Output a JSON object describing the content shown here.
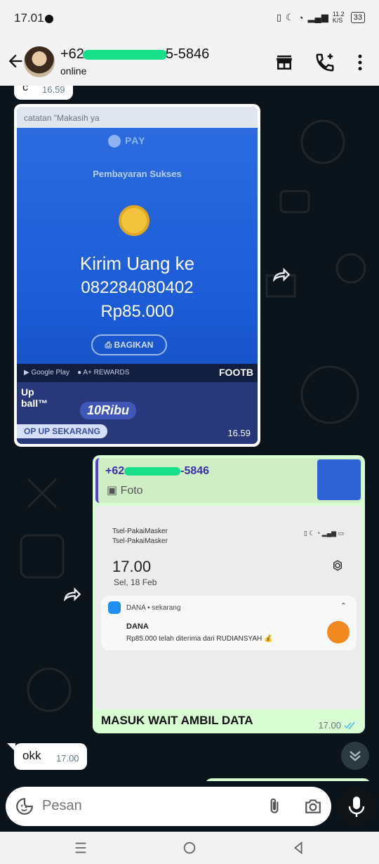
{
  "status_bar": {
    "time": "17.01",
    "net_speed": "11.2 K/S",
    "battery": "33"
  },
  "header": {
    "name_prefix": "+62",
    "name_suffix": "5-5846",
    "status": "online"
  },
  "messages": {
    "partial_top": {
      "text": "c",
      "time": "16.59"
    },
    "image": {
      "time": "16.59",
      "top_note": "catatan \"Makasih ya",
      "pay_brand": "PAY",
      "status": "Pembayaran Sukses",
      "title": "Kirim Uang ke",
      "number": "082284080402",
      "amount": "Rp85.000",
      "share": "BAGIKAN",
      "band_google": "Google Play",
      "band_rewards": "A+ REWARDS",
      "promo_a": "Up\nball™",
      "promo_b": "10Ribu",
      "promo_c": "OP UP SEKARANG",
      "foot_brand": "FOOTB"
    },
    "reply": {
      "quote_name_prefix": "+62",
      "quote_name_suffix": "-5846",
      "quote_type": "Foto",
      "screenshot": {
        "operator1": "Tsel-PakaiMasker",
        "operator2": "Tsel-PakaiMasker",
        "time": "17.00",
        "date": "Sel, 18 Feb",
        "notif_app": "DANA • sekarang",
        "notif_title": "DANA",
        "notif_body": "Rp85.000 telah diterima dari RUDIANSYAH 💰"
      },
      "caption": "MASUK WAIT AMBIL DATA",
      "time": "17.00"
    },
    "okk": {
      "text": "okk",
      "time": "17.00"
    }
  },
  "input": {
    "placeholder": "Pesan"
  },
  "colors": {
    "chat_bg": "#0b141a",
    "outgoing": "#d9fdd3",
    "incoming": "#ffffff",
    "read_tick": "#53bdeb"
  }
}
